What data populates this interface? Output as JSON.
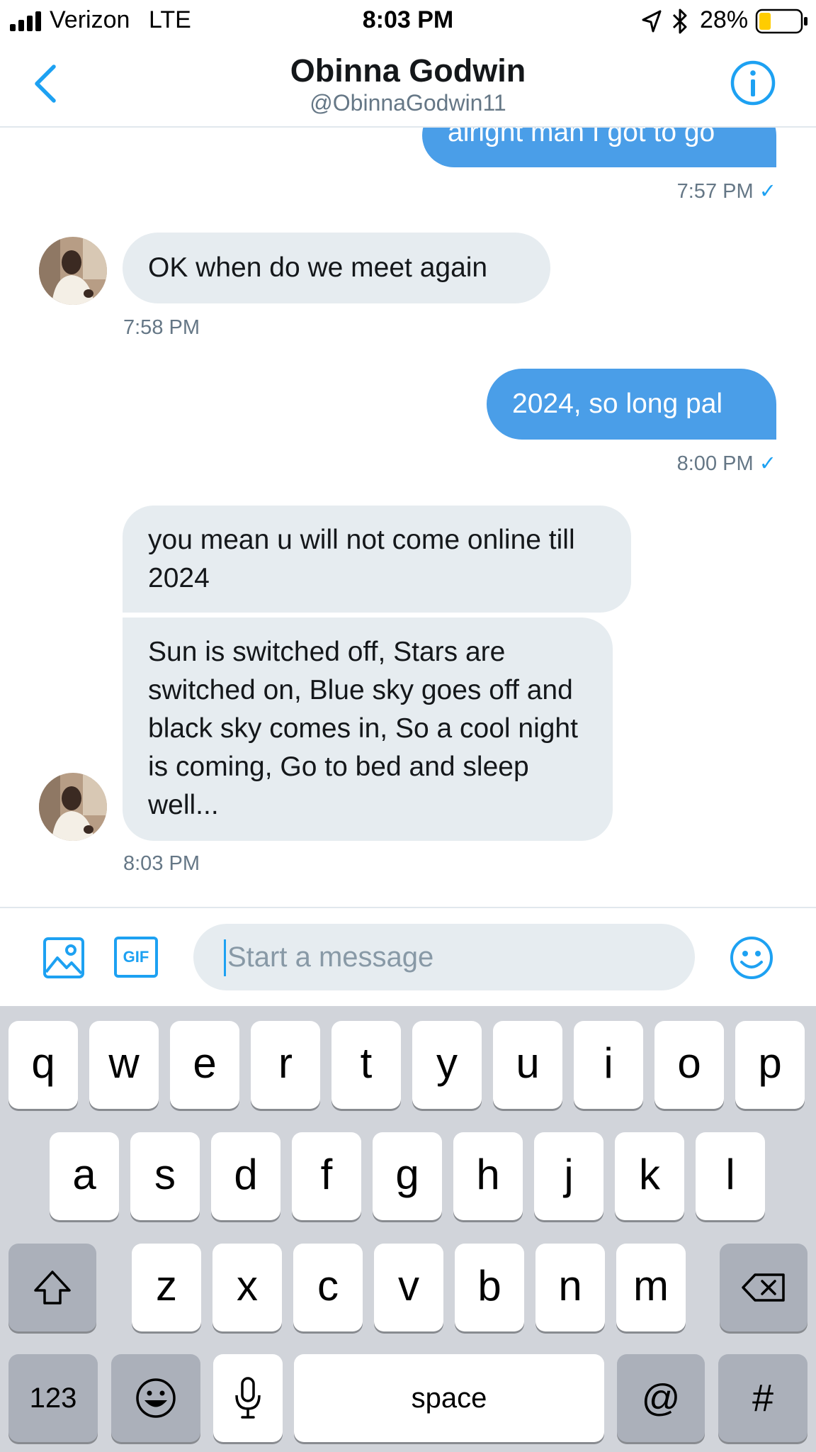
{
  "status_bar": {
    "carrier": "Verizon",
    "network": "LTE",
    "time": "8:03 PM",
    "battery": "28%",
    "battery_level": 0.28
  },
  "header": {
    "back_icon": "chevron-left-icon",
    "name": "Obinna Godwin",
    "handle": "@ObinnaGodwin11",
    "info_icon": "info-icon"
  },
  "conversation": {
    "msg_out_1": {
      "text": "alright man I got to go",
      "time": "7:57 PM"
    },
    "msg_in_1": {
      "text": "OK when do we meet again",
      "time": "7:58 PM"
    },
    "msg_out_2": {
      "text": "2024, so long pal",
      "time": "8:00 PM"
    },
    "msg_in_2": {
      "bubble_1": "you mean u will not come online till 2024",
      "bubble_2": "Sun is switched off, Stars are switched on, Blue sky goes off and black sky comes in, So a cool night is coming, Go to bed and sleep well...",
      "time": "8:03 PM"
    },
    "read_mark": "✓"
  },
  "composer": {
    "placeholder": "Start a message",
    "gif_label": "GIF",
    "icons": [
      "image-icon",
      "gif-icon",
      "emoji-icon"
    ]
  },
  "keyboard": {
    "row1": [
      "q",
      "w",
      "e",
      "r",
      "t",
      "y",
      "u",
      "i",
      "o",
      "p"
    ],
    "row2": [
      "a",
      "s",
      "d",
      "f",
      "g",
      "h",
      "j",
      "k",
      "l"
    ],
    "row3": [
      "z",
      "x",
      "c",
      "v",
      "b",
      "n",
      "m"
    ],
    "numbers_key": "123",
    "space_key": "space",
    "at_key": "@",
    "hash_key": "#"
  },
  "colors": {
    "accent": "#1da1f2",
    "outgoing_bubble": "#4a9ee8",
    "incoming_bubble": "#e6ecf0",
    "keyboard_bg": "#d1d4da"
  }
}
